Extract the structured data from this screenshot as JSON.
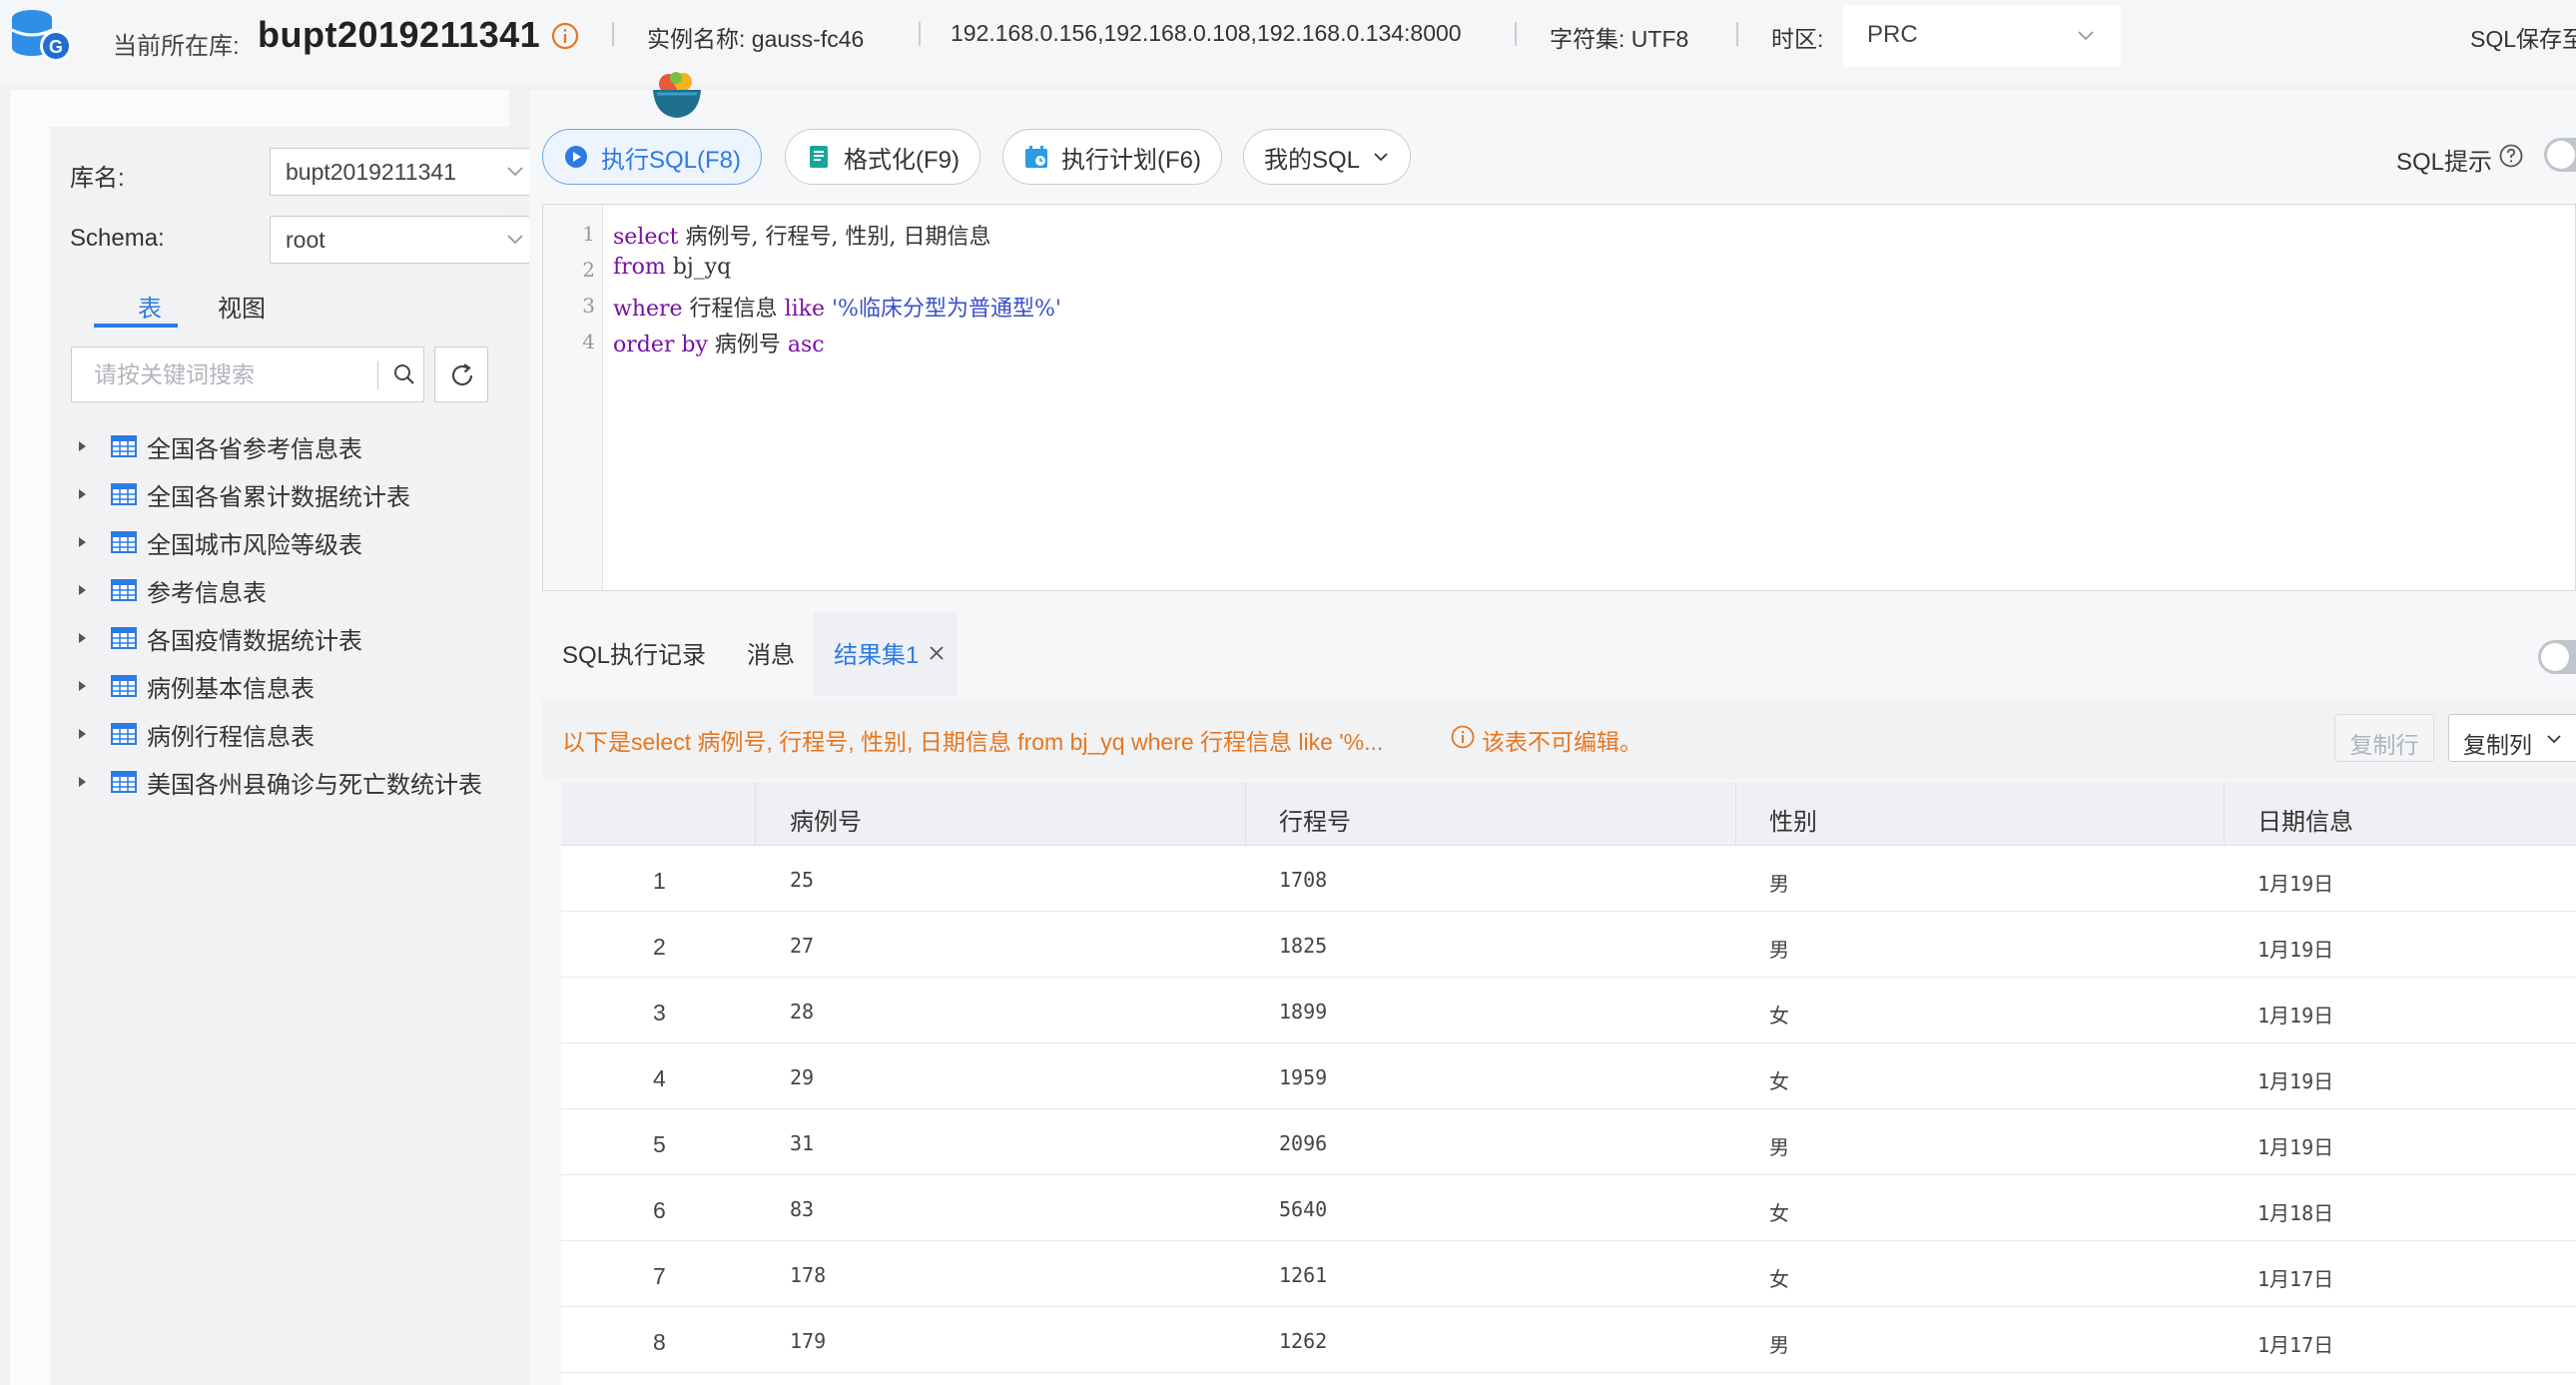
{
  "topbar": {
    "current_db_label": "当前所在库:",
    "current_db": "bupt2019211341",
    "instance_text": "实例名称: gauss-fc46",
    "hosts": "192.168.0.156,192.168.0.108,192.168.0.134:8000",
    "charset_text": "字符集: UTF8",
    "timezone_label": "时区:",
    "timezone_value": "PRC",
    "sql_save_text": "SQL保存至"
  },
  "left": {
    "db_label": "库名:",
    "db_value": "bupt2019211341",
    "schema_label": "Schema:",
    "schema_value": "root",
    "tab_tables": "表",
    "tab_views": "视图",
    "search_placeholder": "请按关键词搜索",
    "tables": [
      "全国各省参考信息表",
      "全国各省累计数据统计表",
      "全国城市风险等级表",
      "参考信息表",
      "各国疫情数据统计表",
      "病例基本信息表",
      "病例行程信息表",
      "美国各州县确诊与死亡数统计表"
    ]
  },
  "toolbar": {
    "execute": "执行SQL(F8)",
    "format": "格式化(F9)",
    "plan": "执行计划(F6)",
    "my_sql": "我的SQL",
    "sql_hint": "SQL提示"
  },
  "editor": {
    "line_numbers": [
      "1",
      "2",
      "3",
      "4"
    ],
    "l1_kw": "select",
    "l1_rest": " 病例号, 行程号, 性别, 日期信息",
    "l2_kw": "from",
    "l2_rest": " bj_yq",
    "l3_kw1": "where",
    "l3_mid": " 行程信息 ",
    "l3_kw2": "like",
    "l3_str": " '%临床分型为普通型%'",
    "l4_kw1": "order by",
    "l4_mid": " 病例号 ",
    "l4_kw2": "asc"
  },
  "results": {
    "tab_history": "SQL执行记录",
    "tab_messages": "消息",
    "tab_resultset": "结果集1",
    "notice": "以下是select 病例号, 行程号, 性别, 日期信息 from bj_yq where 行程信息 like '%...",
    "not_editable": "该表不可编辑。",
    "copy_row": "复制行",
    "copy_col": "复制列",
    "columns": [
      "病例号",
      "行程号",
      "性别",
      "日期信息"
    ],
    "rows": [
      {
        "idx": "1",
        "case": "25",
        "trip": "1708",
        "sex": "男",
        "date": "1月19日"
      },
      {
        "idx": "2",
        "case": "27",
        "trip": "1825",
        "sex": "男",
        "date": "1月19日"
      },
      {
        "idx": "3",
        "case": "28",
        "trip": "1899",
        "sex": "女",
        "date": "1月19日"
      },
      {
        "idx": "4",
        "case": "29",
        "trip": "1959",
        "sex": "女",
        "date": "1月19日"
      },
      {
        "idx": "5",
        "case": "31",
        "trip": "2096",
        "sex": "男",
        "date": "1月19日"
      },
      {
        "idx": "6",
        "case": "83",
        "trip": "5640",
        "sex": "女",
        "date": "1月18日"
      },
      {
        "idx": "7",
        "case": "178",
        "trip": "1261",
        "sex": "女",
        "date": "1月17日"
      },
      {
        "idx": "8",
        "case": "179",
        "trip": "1262",
        "sex": "男",
        "date": "1月17日"
      }
    ]
  },
  "colors": {
    "accent": "#2c7be5",
    "warning": "#e6761f",
    "keyword": "#7a0fa4",
    "string": "#3a4fc7"
  },
  "icons": {
    "logo": "database-g-logo-icon",
    "info": "info-circle-icon",
    "execute": "play-circle-icon",
    "format": "document-icon",
    "plan": "calendar-plan-icon",
    "help": "question-circle-icon",
    "search": "search-icon",
    "refresh": "refresh-icon",
    "table": "table-grid-icon",
    "expand": "caret-right-icon"
  }
}
